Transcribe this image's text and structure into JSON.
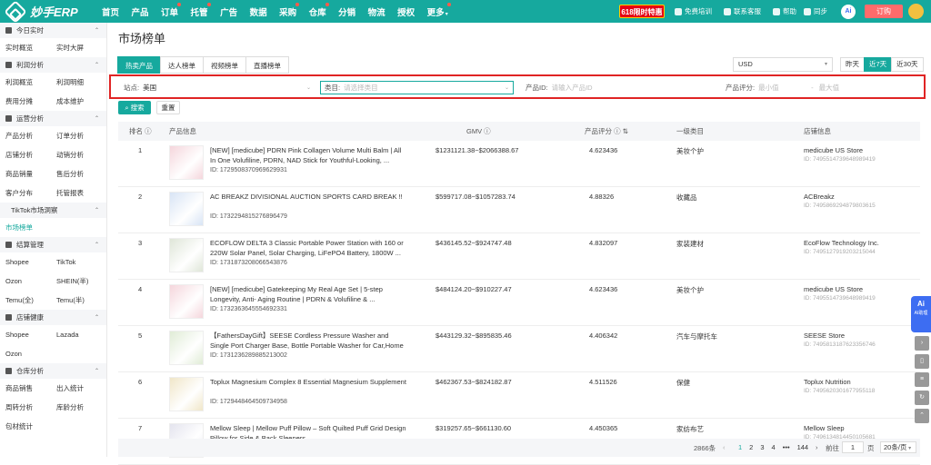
{
  "topbar": {
    "brand": "妙手ERP",
    "nav": [
      {
        "label": "首页",
        "arrow": false,
        "dot": false
      },
      {
        "label": "产品",
        "arrow": false,
        "dot": false
      },
      {
        "label": "订单",
        "arrow": false,
        "dot": true
      },
      {
        "label": "托管",
        "arrow": false,
        "dot": true
      },
      {
        "label": "广告",
        "arrow": false,
        "dot": false
      },
      {
        "label": "数据",
        "arrow": false,
        "dot": false
      },
      {
        "label": "采购",
        "arrow": false,
        "dot": true
      },
      {
        "label": "仓库",
        "arrow": false,
        "dot": true
      },
      {
        "label": "分销",
        "arrow": false,
        "dot": false
      },
      {
        "label": "物流",
        "arrow": false,
        "dot": false
      },
      {
        "label": "授权",
        "arrow": false,
        "dot": false
      },
      {
        "label": "更多",
        "arrow": true,
        "dot": true
      }
    ],
    "promo": "618限时特惠",
    "training": "免费培训",
    "support": "联系客服",
    "help": "帮助",
    "sync": "同步",
    "ai": "Ai",
    "order": "订购"
  },
  "sidebar": {
    "sections": [
      {
        "title": "今日实时",
        "rows": [
          [
            "实时概览",
            "实时大屏"
          ]
        ]
      },
      {
        "title": "利润分析",
        "rows": [
          [
            "利润概览",
            "利润明细"
          ],
          [
            "费用分摊",
            "成本维护"
          ]
        ]
      },
      {
        "title": "运营分析",
        "rows": [
          [
            "产品分析",
            "订单分析"
          ],
          [
            "店铺分析",
            "动销分析"
          ],
          [
            "商品销量",
            "售后分析"
          ],
          [
            "客户分布",
            "托管报表"
          ]
        ]
      },
      {
        "title": "TikTok市场洞察",
        "rows": [
          [
            "市场榜单",
            ""
          ]
        ]
      },
      {
        "title": "结算管理",
        "rows": [
          [
            "Shopee",
            "TikTok"
          ],
          [
            "Ozon",
            "SHEIN(半)"
          ],
          [
            "Temu(全)",
            "Temu(半)"
          ]
        ]
      },
      {
        "title": "店铺健康",
        "rows": [
          [
            "Shopee",
            "Lazada"
          ],
          [
            "Ozon",
            ""
          ]
        ]
      },
      {
        "title": "仓库分析",
        "rows": [
          [
            "商品销售",
            "出入统计"
          ],
          [
            "周转分析",
            "库龄分析"
          ],
          [
            "包材统计",
            ""
          ]
        ]
      }
    ],
    "active": "市场榜单"
  },
  "page": {
    "title": "市场榜单",
    "tabs": [
      "热卖产品",
      "达人榜单",
      "视频榜单",
      "直播榜单"
    ],
    "active_tab": "热卖产品",
    "currency": "USD",
    "ranges": [
      "昨天",
      "近7天",
      "近30天"
    ],
    "active_range": "近7天"
  },
  "filters": {
    "site_label": "站点:",
    "site_value": "美国",
    "category_label": "类目:",
    "category_placeholder": "请选择类目",
    "product_id_label": "产品ID:",
    "product_id_placeholder": "请输入产品ID",
    "rating_label": "产品评分:",
    "min_placeholder": "最小值",
    "separator": "-",
    "max_placeholder": "最大值",
    "search_btn": "搜索",
    "reset_btn": "重置"
  },
  "table": {
    "headers": {
      "rank": "排名",
      "product": "产品信息",
      "gmv": "GMV",
      "score": "产品评分",
      "category": "一级类目",
      "store": "店铺信息"
    },
    "rows": [
      {
        "rank": "1",
        "name": "[NEW] [medicube] PDRN Pink Collagen Volume Multi Balm | All In One Volufiline, PDRN, NAD Stick for Youthful-Looking, ...",
        "id": "ID: 1729508370969629931",
        "gmv": "$1231121.38~$2066388.67",
        "score": "4.623436",
        "category": "美妆个护",
        "store": "medicube US Store",
        "store_id": "ID: 7495514739648989419",
        "thumb": "#f5d6dc"
      },
      {
        "rank": "2",
        "name": "AC BREAKZ DIVISIONAL AUCTION SPORTS CARD BREAK !!",
        "id": "ID: 1732294815276896479",
        "gmv": "$599717.08~$1057283.74",
        "score": "4.88326",
        "category": "收藏品",
        "store": "ACBreakz",
        "store_id": "ID: 7495869294879803615",
        "thumb": "#d8e4f5"
      },
      {
        "rank": "3",
        "name": "ECOFLOW DELTA 3 Classic Portable Power Station with 160 or 220W Solar Panel, Solar Charging, LiFePO4 Battery, 1800W ...",
        "id": "ID: 1731873208066543876",
        "gmv": "$436145.52~$924747.48",
        "score": "4.832097",
        "category": "家装建材",
        "store": "EcoFlow Technology Inc.",
        "store_id": "ID: 7495127919203215044",
        "thumb": "#dfe6d8"
      },
      {
        "rank": "4",
        "name": "[NEW] [medicube] Gatekeeping My Real Age Set | 5-step Longevity, Anti- Aging Routine | PDRN & Volufiline & ...",
        "id": "ID: 1732363645554692331",
        "gmv": "$484124.20~$910227.47",
        "score": "4.623436",
        "category": "美妆个护",
        "store": "medicube US Store",
        "store_id": "ID: 7495514739648989419",
        "thumb": "#f5d6dc"
      },
      {
        "rank": "5",
        "name": "【FathersDayGift】SEESE Cordless Pressure Washer and Single Port Charger Base, Bottle Portable Washer for Car,Home ...",
        "id": "ID: 1731236289885213002",
        "gmv": "$443129.32~$895835.46",
        "score": "4.406342",
        "category": "汽车与摩托车",
        "store": "SEESE Store",
        "store_id": "ID: 7495813187623356746",
        "thumb": "#e0ecd6"
      },
      {
        "rank": "6",
        "name": "Toplux Magnesium Complex 8 Essential Magnesium Supplement",
        "id": "ID: 1729448464509734958",
        "gmv": "$462367.53~$824182.87",
        "score": "4.511526",
        "category": "保健",
        "store": "Toplux Nutrition",
        "store_id": "ID: 7495620301677955118",
        "thumb": "#f0e6c8"
      },
      {
        "rank": "7",
        "name": "Mellow Sleep | Mellow Puff Pillow – Soft Quilted Puff Grid Design Pillow for Side & Back Sleepers",
        "id": "",
        "gmv": "$319257.65~$661130.60",
        "score": "4.450365",
        "category": "家纺布艺",
        "store": "Mellow Sleep",
        "store_id": "ID: 7496134814450105681",
        "thumb": "#e4e4ee"
      }
    ]
  },
  "pager": {
    "total": "2866条",
    "prev": "‹",
    "pages": [
      "1",
      "2",
      "3",
      "4",
      "•••",
      "144"
    ],
    "active_page": "1",
    "next": "›",
    "goto_label": "前往",
    "goto_value": "1",
    "page_unit": "页",
    "page_size": "20条/页"
  },
  "dock": {
    "ai_label": "Ai",
    "ai_sub": "AI助理"
  },
  "colors": {
    "primary": "#16a99e",
    "highlight_box": "#e02424",
    "promo": "#e60012"
  }
}
